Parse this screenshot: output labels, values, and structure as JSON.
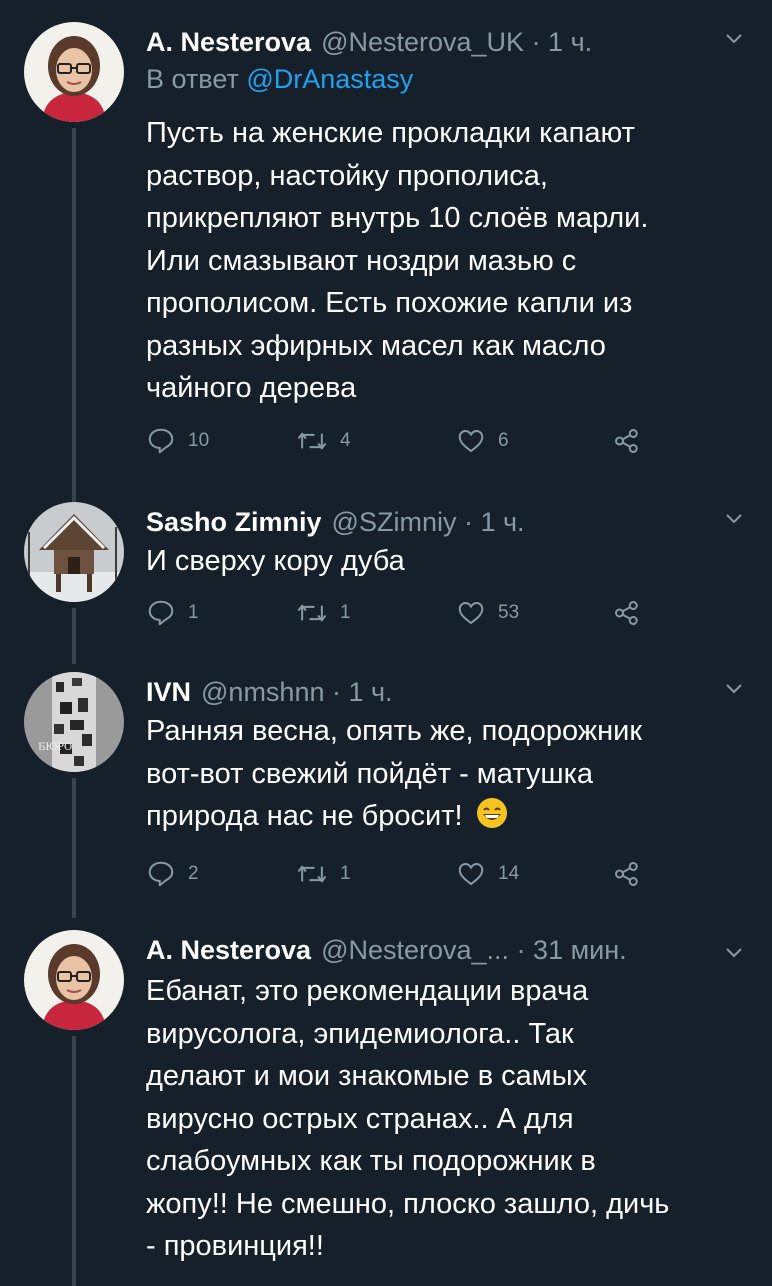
{
  "tweets": [
    {
      "name": "A. Nesterova",
      "meta": "@Nesterova_UK · 1 ч.",
      "reply_label": "В ответ",
      "reply_mention": "@DrAnastasy",
      "lines": [
        "Пусть на женские прокладки капают",
        "раствор, настойку прополиса,",
        "прикрепляют внутрь 10 слоёв марли.",
        "Или смазывают ноздри мазью с",
        "прополисом.  Есть похожие капли из",
        "разных эфирных масел как масло",
        "чайного дерева"
      ],
      "replies": "10",
      "retweets": "4",
      "likes": "6"
    },
    {
      "name": "Sasho Zimniy",
      "meta": "@SZimniy · 1 ч.",
      "lines": [
        "И сверху кору дуба"
      ],
      "replies": "1",
      "retweets": "1",
      "likes": "53"
    },
    {
      "name": "IVN",
      "meta": "@nmshnn · 1 ч.",
      "avatar_text": "БЮРО",
      "lines": [
        "Ранняя весна, опять же, подорожник",
        "вот-вот свежий пойдёт - матушка",
        "природа нас не бросит!"
      ],
      "emoji": "grinning-face-with-smiling-eyes",
      "replies": "2",
      "retweets": "1",
      "likes": "14"
    },
    {
      "name": "A. Nesterova",
      "meta": "@Nesterova_... · 31 мин.",
      "lines": [
        "Ебанат, это рекомендации врача",
        "вирусолога, эпидемиолога.. Так",
        "делают и мои знакомые в самых",
        "вирусно острых странах.. А для",
        "слабоумных как ты подорожник в",
        "жопу!! Не смешно, плоско зашло, дичь",
        "- провинция!!"
      ]
    }
  ],
  "icons": {
    "reply": "reply-icon",
    "retweet": "retweet-icon",
    "like": "heart-icon",
    "share": "share-icon",
    "menu": "chevron-down-icon"
  },
  "colors": {
    "background": "#15202b",
    "text_primary": "#ffffff",
    "text_secondary": "#8899a6",
    "link": "#1da1f2",
    "thread_line": "#38444d"
  }
}
